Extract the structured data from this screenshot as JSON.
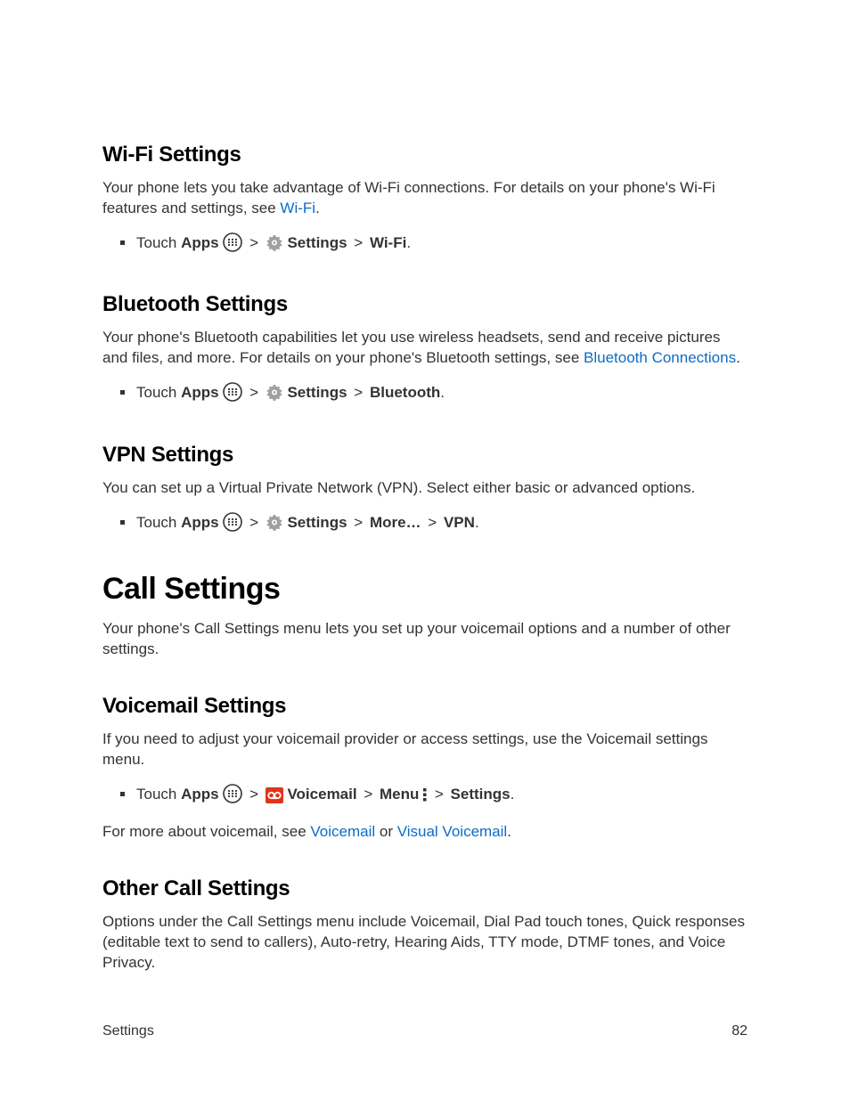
{
  "sections": {
    "wifi": {
      "heading": "Wi-Fi Settings",
      "body_pre": "Your phone lets you take advantage of Wi-Fi connections. For details on your phone's Wi-Fi features and settings, see ",
      "link": "Wi-Fi",
      "body_post": ".",
      "bullet": {
        "touch": "Touch ",
        "apps": "Apps",
        "settings": "Settings",
        "wifi": "Wi-Fi",
        "end": "."
      }
    },
    "bluetooth": {
      "heading": "Bluetooth Settings",
      "body_pre": "Your phone's Bluetooth capabilities let you use wireless headsets, send and receive pictures and files, and more. For details on your phone's Bluetooth settings, see ",
      "link": "Bluetooth Connections",
      "body_post": ".",
      "bullet": {
        "touch": "Touch ",
        "apps": "Apps",
        "settings": "Settings",
        "bluetooth": "Bluetooth",
        "end": "."
      }
    },
    "vpn": {
      "heading": "VPN Settings",
      "body": "You can set up a Virtual Private Network (VPN). Select either basic or advanced options.",
      "bullet": {
        "touch": "Touch ",
        "apps": "Apps",
        "settings": "Settings",
        "more": "More…",
        "vpn": "VPN",
        "end": "."
      }
    },
    "call": {
      "heading": "Call Settings",
      "body": "Your phone's Call Settings menu lets you set up your voicemail options and a number of other settings."
    },
    "voicemail": {
      "heading": "Voicemail Settings",
      "body": "If you need to adjust your voicemail provider or access settings, use the Voicemail settings menu.",
      "bullet": {
        "touch": "Touch ",
        "apps": "Apps",
        "voicemail": "Voicemail",
        "menu": "Menu",
        "settings": "Settings",
        "end": "."
      },
      "footnote_pre": "For more about voicemail, see ",
      "link1": "Voicemail",
      "mid": " or ",
      "link2": "Visual Voicemail",
      "footnote_post": "."
    },
    "other": {
      "heading": "Other Call Settings",
      "body": "Options under the Call Settings menu include Voicemail, Dial Pad touch tones, Quick responses (editable text to send to callers), Auto-retry, Hearing Aids, TTY mode, DTMF tones, and Voice Privacy."
    }
  },
  "nav": {
    "gt": ">"
  },
  "footer": {
    "left": "Settings",
    "right": "82"
  }
}
